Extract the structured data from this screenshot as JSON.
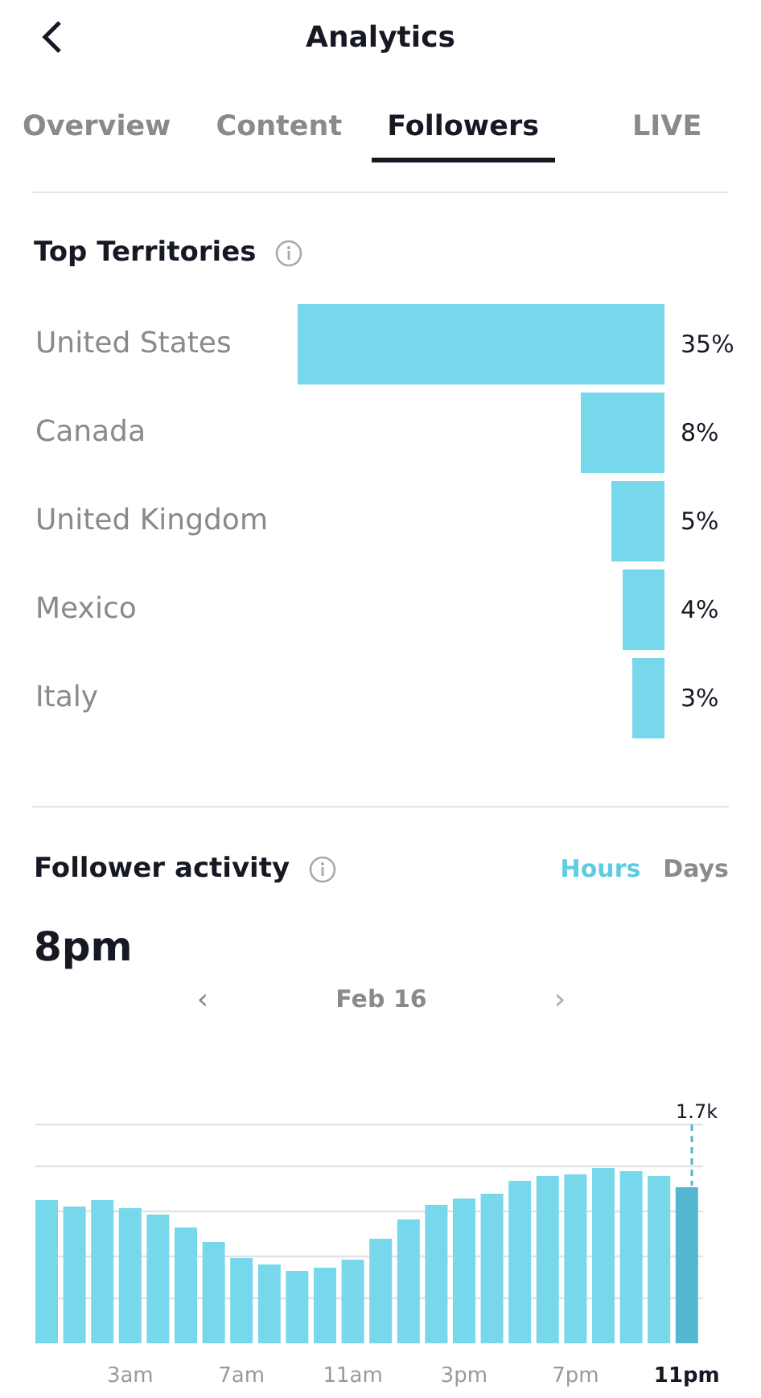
{
  "header": {
    "title": "Analytics"
  },
  "tabs": [
    {
      "label": "Overview",
      "selected": false
    },
    {
      "label": "Content",
      "selected": false
    },
    {
      "label": "Followers",
      "selected": true
    },
    {
      "label": "LIVE",
      "selected": false
    }
  ],
  "top_territories": {
    "title": "Top Territories",
    "chart_data": {
      "type": "bar",
      "orientation": "horizontal",
      "categories": [
        "United States",
        "Canada",
        "United Kingdom",
        "Mexico",
        "Italy"
      ],
      "values": [
        35,
        8,
        5,
        4,
        3
      ],
      "value_labels": [
        "35%",
        "8%",
        "5%",
        "4%",
        "3%"
      ]
    }
  },
  "follower_activity": {
    "title": "Follower activity",
    "modes": [
      {
        "label": "Hours",
        "selected": true
      },
      {
        "label": "Days",
        "selected": false
      }
    ],
    "time": "8pm",
    "date": "Feb 16",
    "prev": "‹",
    "next": "›",
    "highlight_value": "1.7k",
    "hour_labels": [
      {
        "label": "3am",
        "selected": false
      },
      {
        "label": "7am",
        "selected": false
      },
      {
        "label": "11am",
        "selected": false
      },
      {
        "label": "3pm",
        "selected": false
      },
      {
        "label": "7pm",
        "selected": false
      },
      {
        "label": "11pm",
        "selected": true
      }
    ]
  }
}
